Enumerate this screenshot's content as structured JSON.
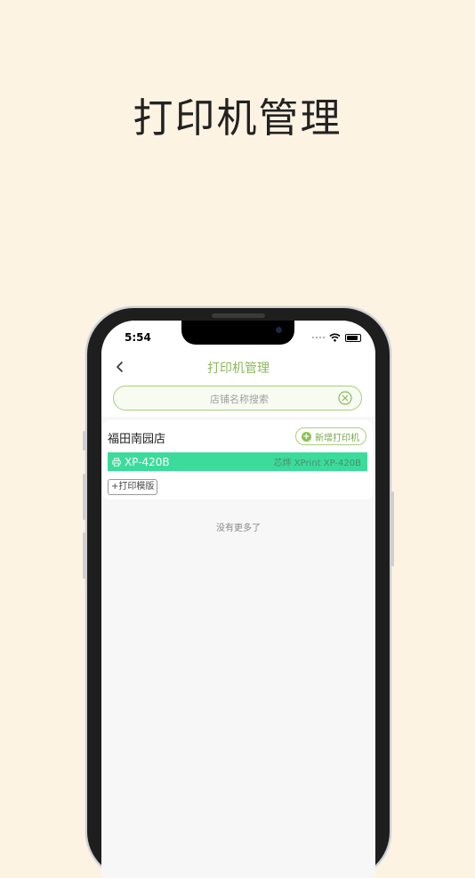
{
  "promo": {
    "title": "打印机管理"
  },
  "status_bar": {
    "time": "5:54"
  },
  "nav": {
    "title": "打印机管理"
  },
  "search": {
    "placeholder": "店铺名称搜索"
  },
  "stores": [
    {
      "name": "福田南园店",
      "add_printer_label": "新增打印机",
      "printers": [
        {
          "model": "XP-420B",
          "brand": "芯烨 XPrint XP-420B"
        }
      ],
      "template_button": "+打印模版"
    }
  ],
  "footer": {
    "no_more": "没有更多了"
  },
  "colors": {
    "accent": "#8cb75a",
    "printer_row": "#3bdc9b",
    "background": "#fdf3e2"
  }
}
